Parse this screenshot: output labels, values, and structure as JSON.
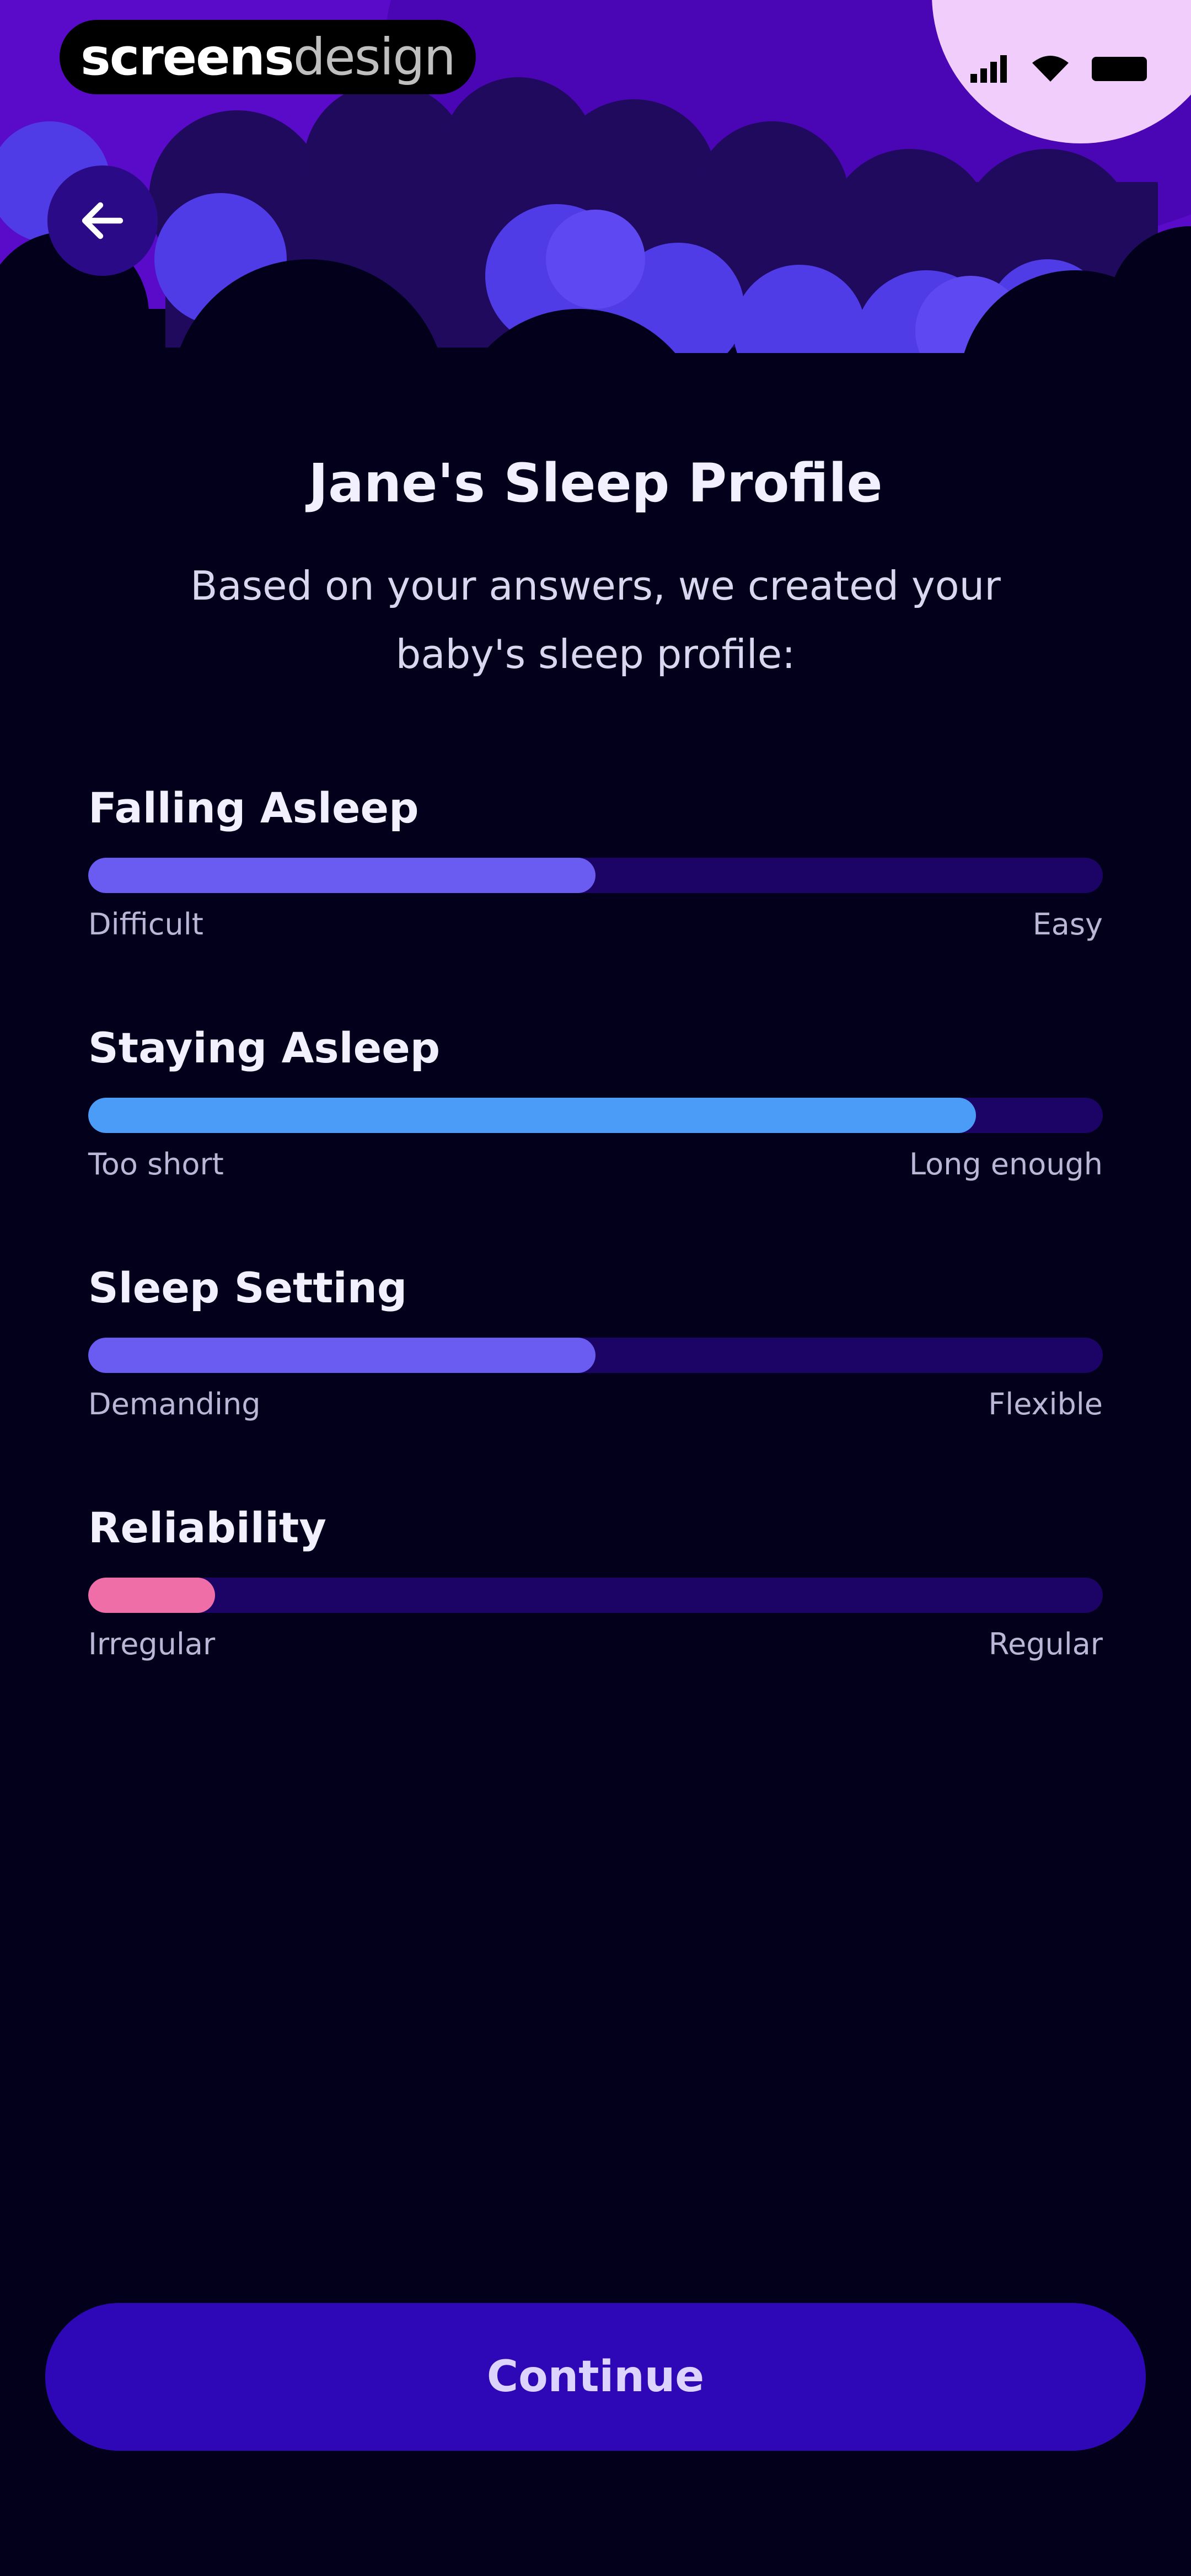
{
  "brand": {
    "part1": "screens",
    "part2": "design"
  },
  "header": {
    "back_icon": "arrow-left-icon"
  },
  "profile": {
    "title": "Jane's Sleep Profile",
    "subtitle": "Based on your answers, we created your baby's sleep profile:"
  },
  "metrics": [
    {
      "label": "Falling Asleep",
      "left": "Difficult",
      "right": "Easy",
      "value": 0.5,
      "color": "#6a5cf0"
    },
    {
      "label": "Staying Asleep",
      "left": "Too short",
      "right": "Long enough",
      "value": 0.875,
      "color": "#4b9cf7"
    },
    {
      "label": "Sleep Setting",
      "left": "Demanding",
      "right": "Flexible",
      "value": 0.5,
      "color": "#6a5cf0"
    },
    {
      "label": "Reliability",
      "left": "Irregular",
      "right": "Regular",
      "value": 0.125,
      "color": "#f06ea7"
    }
  ],
  "actions": {
    "continue_label": "Continue"
  }
}
